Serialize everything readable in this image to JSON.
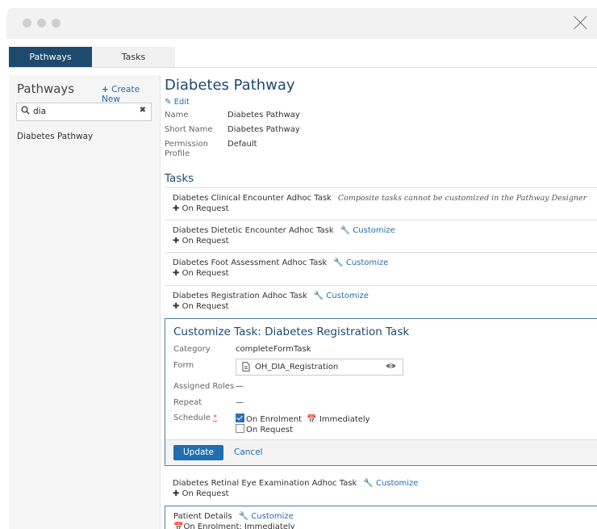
{
  "tabs": [
    {
      "label": "Pathways"
    },
    {
      "label": "Tasks"
    }
  ],
  "sidebar": {
    "title": "Pathways",
    "create_label": "Create New",
    "search_value": "dia",
    "items": [
      {
        "label": "Diabetes Pathway"
      }
    ]
  },
  "main": {
    "title": "Diabetes Pathway",
    "edit_label": "Edit",
    "fields": [
      {
        "label": "Name",
        "value": "Diabetes Pathway"
      },
      {
        "label": "Short Name",
        "value": "Diabetes Pathway"
      },
      {
        "label": "Permission Profile",
        "value": "Default"
      }
    ],
    "tasks_title": "Tasks",
    "tasks": [
      {
        "name": "Diabetes Clinical Encounter Adhoc Task",
        "note": "Composite tasks cannot be customized in the Pathway Designer",
        "sub": "On Request"
      },
      {
        "name": "Diabetes Dietetic Encounter Adhoc Task",
        "action": "Customize",
        "sub": "On Request"
      },
      {
        "name": "Diabetes Foot Assessment Adhoc Task",
        "action": "Customize",
        "sub": "On Request"
      },
      {
        "name": "Diabetes Registration Adhoc Task",
        "action": "Customize",
        "sub": "On Request"
      }
    ],
    "customize": {
      "title": "Customize Task: Diabetes Registration Task",
      "category_label": "Category",
      "category_value": "completeFormTask",
      "form_label": "Form",
      "form_value": "OH_DIA_Registration",
      "roles_label": "Assigned Roles",
      "roles_value": "—",
      "repeat_label": "Repeat",
      "repeat_value": "—",
      "schedule_label": "Schedule",
      "required_mark": "*",
      "opt_enrolment": "On Enrolment",
      "opt_enrolment_checked": true,
      "opt_immediately": "Immediately",
      "opt_request": "On Request",
      "opt_request_checked": false,
      "update_label": "Update",
      "cancel_label": "Cancel"
    },
    "after_tasks": [
      {
        "name": "Diabetes Retinal Eye Examination Adhoc Task",
        "action": "Customize",
        "sub": "On Request"
      }
    ],
    "patient": {
      "name": "Patient Details",
      "action": "Customize",
      "sub": "On Enrolment: Immediately"
    }
  }
}
